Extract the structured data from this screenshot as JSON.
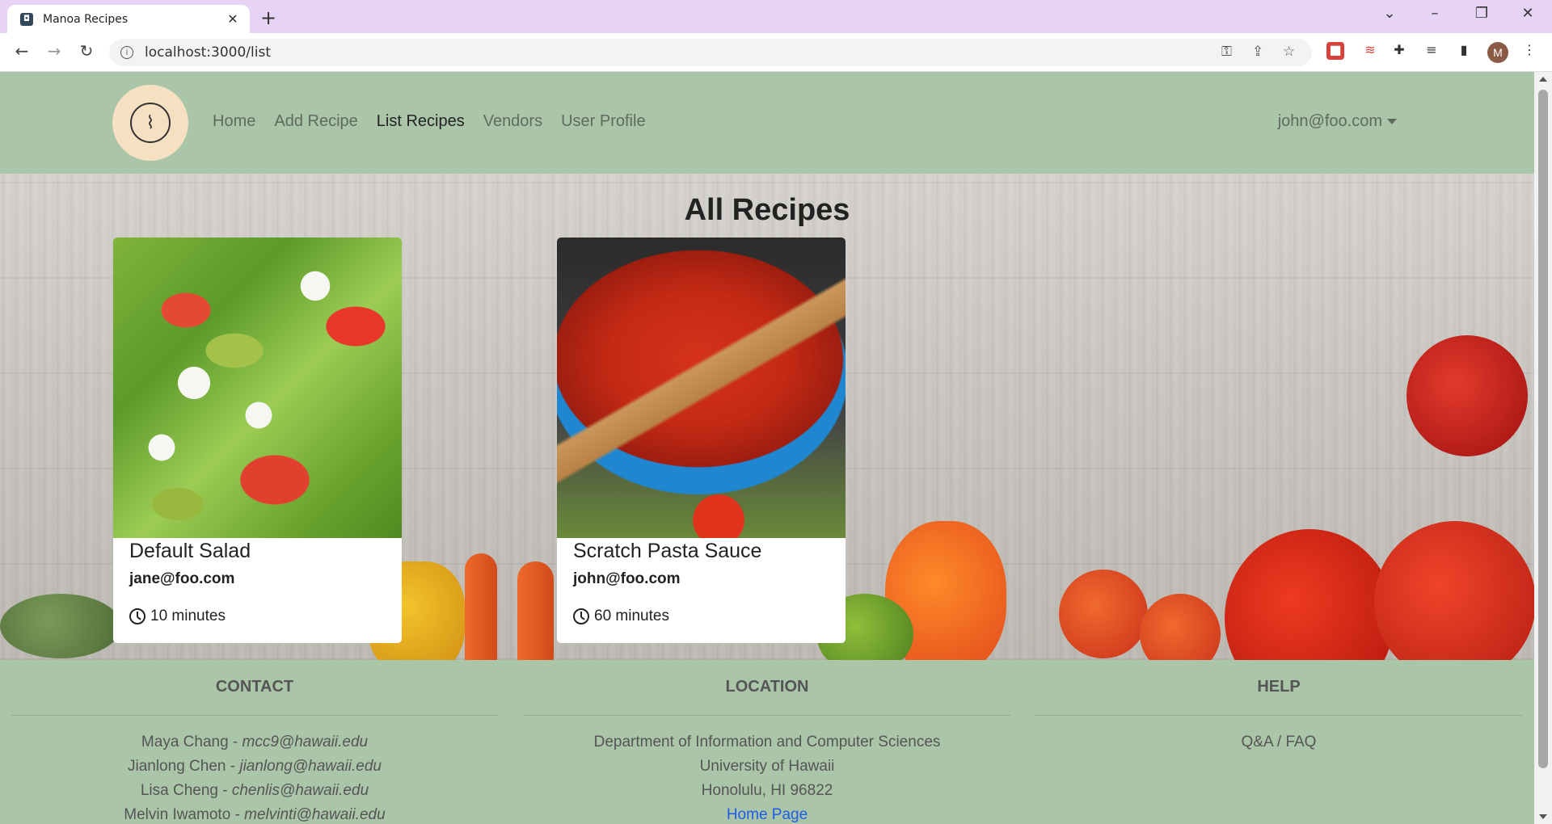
{
  "browser": {
    "tab_title": "Manoa Recipes",
    "tab_close": "✕",
    "new_tab": "+",
    "url": "localhost:3000/list",
    "profile_initial": "M"
  },
  "navbar": {
    "links": [
      {
        "label": "Home"
      },
      {
        "label": "Add Recipe"
      },
      {
        "label": "List Recipes"
      },
      {
        "label": "Vendors"
      },
      {
        "label": "User Profile"
      }
    ],
    "active": "List Recipes",
    "user": "john@foo.com"
  },
  "page": {
    "title": "All Recipes"
  },
  "recipes": [
    {
      "name": "Default Salad",
      "owner": "jane@foo.com",
      "time": "10 minutes"
    },
    {
      "name": "Scratch Pasta Sauce",
      "owner": "john@foo.com",
      "time": "60 minutes"
    }
  ],
  "footer": {
    "contact": {
      "heading": "CONTACT",
      "people": [
        {
          "name": "Maya Chang - ",
          "email": "mcc9@hawaii.edu"
        },
        {
          "name": "Jianlong Chen - ",
          "email": "jianlong@hawaii.edu"
        },
        {
          "name": "Lisa Cheng - ",
          "email": "chenlis@hawaii.edu"
        },
        {
          "name": "Melvin Iwamoto - ",
          "email": "melvinti@hawaii.edu"
        }
      ]
    },
    "location": {
      "heading": "LOCATION",
      "lines": [
        "Department of Information and Computer Sciences",
        "University of Hawaii",
        "Honolulu, HI 96822"
      ],
      "link": "Home Page"
    },
    "help": {
      "heading": "HELP",
      "link": "Q&A / FAQ"
    }
  },
  "colors": {
    "navbar_bg": "#abc5a9",
    "footer_bg": "#abc5a9",
    "link": "#1d5de6",
    "tabbar_bg": "#e7d3f6"
  }
}
